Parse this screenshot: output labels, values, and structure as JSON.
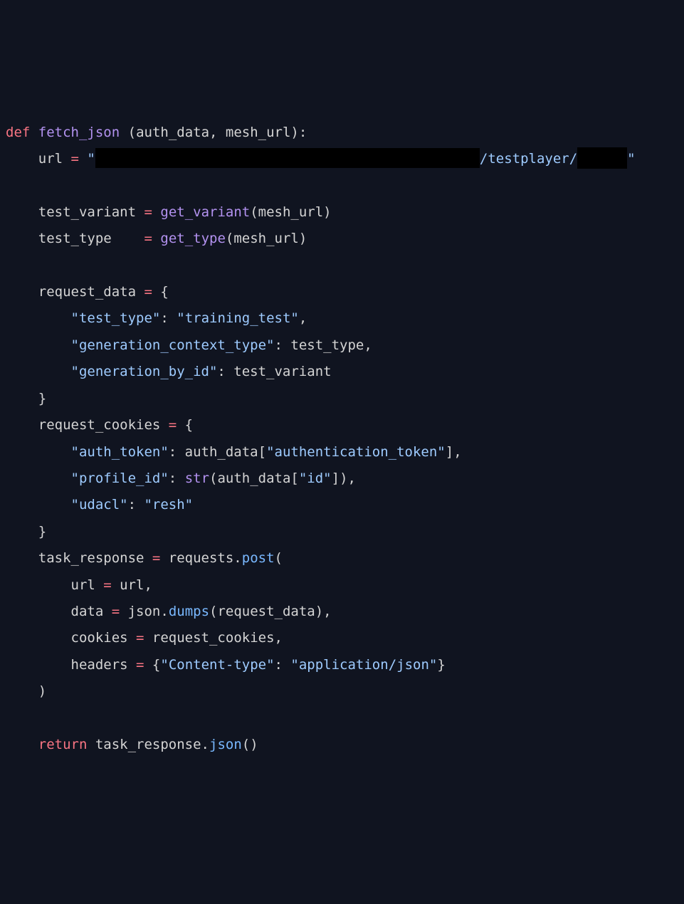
{
  "tokens": {
    "t0": "def",
    "t1": " ",
    "t2": "fetch_json",
    "t3": " (",
    "t4": "auth_data",
    "t5": ", ",
    "t6": "mesh_url",
    "t7": "):",
    "t8": "    url ",
    "t9": "=",
    "t10": " ",
    "t11": "\"",
    "t12": "/testplayer/",
    "t13": "\"",
    "t14": "    test_variant ",
    "t15": "=",
    "t16": " ",
    "t17": "get_variant",
    "t18": "(mesh_url)",
    "t19": "    test_type    ",
    "t20": "=",
    "t21": " ",
    "t22": "get_type",
    "t23": "(mesh_url)",
    "t24": "    request_data ",
    "t25": "=",
    "t26": " {",
    "t27": "        ",
    "t28": "\"test_type\"",
    "t29": ": ",
    "t30": "\"training_test\"",
    "t31": ",",
    "t32": "        ",
    "t33": "\"generation_context_type\"",
    "t34": ": test_type,",
    "t35": "        ",
    "t36": "\"generation_by_id\"",
    "t37": ": test_variant",
    "t38": "    }",
    "t39": "    request_cookies ",
    "t40": "=",
    "t41": " {",
    "t42": "        ",
    "t43": "\"auth_token\"",
    "t44": ": auth_data[",
    "t45": "\"authentication_token\"",
    "t46": "],",
    "t47": "        ",
    "t48": "\"profile_id\"",
    "t49": ": ",
    "t50": "str",
    "t51": "(auth_data[",
    "t52": "\"id\"",
    "t53": "]),",
    "t54": "        ",
    "t55": "\"udacl\"",
    "t56": ": ",
    "t57": "\"resh\"",
    "t58": "    }",
    "t59": "    task_response ",
    "t60": "=",
    "t61": " requests.",
    "t62": "post",
    "t63": "(",
    "t64": "        url ",
    "t65": "=",
    "t66": " url,",
    "t67": "        data ",
    "t68": "=",
    "t69": " json.",
    "t70": "dumps",
    "t71": "(request_data),",
    "t72": "        cookies ",
    "t73": "=",
    "t74": " request_cookies,",
    "t75": "        headers ",
    "t76": "=",
    "t77": " {",
    "t78": "\"Content-type\"",
    "t79": ": ",
    "t80": "\"application/json\"",
    "t81": "}",
    "t82": "    )",
    "t83": "    ",
    "t84": "return",
    "t85": " task_response.",
    "t86": "json",
    "t87": "()"
  }
}
